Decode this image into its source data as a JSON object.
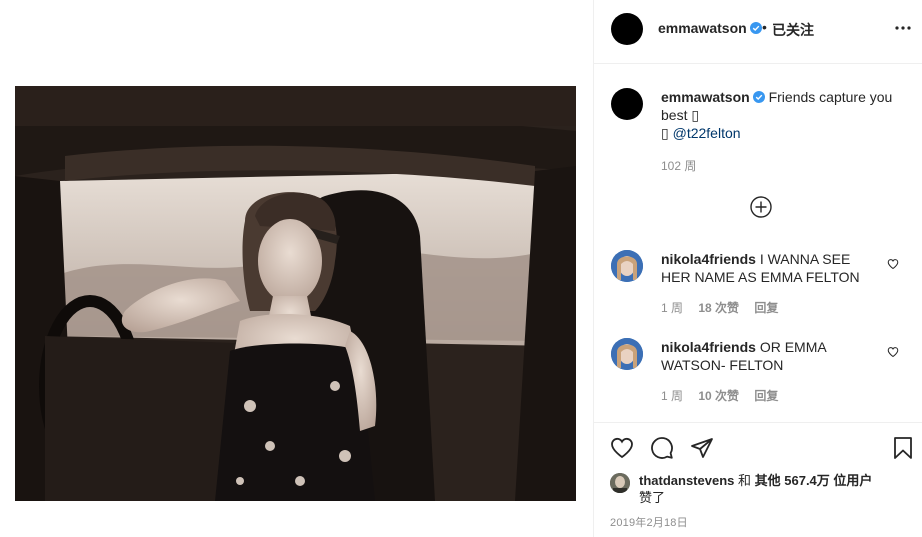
{
  "header": {
    "username": "emmawatson",
    "separator": "•",
    "follow_status": "已关注",
    "more_icon": "more-horizontal-icon"
  },
  "caption": {
    "username": "emmawatson",
    "text": "Friends capture you best",
    "emoji_1": "▯",
    "emoji_2": "▯",
    "mention": "@t22felton",
    "time": "102 周"
  },
  "load_more_icon": "plus-circle-icon",
  "comments": [
    {
      "username": "nikola4friends",
      "text": "I WANNA SEE HER NAME AS EMMA FELTON",
      "time": "1 周",
      "likes": "18 次赞",
      "reply": "回复"
    },
    {
      "username": "nikola4friends",
      "text": "OR EMMA WATSON- FELTON",
      "time": "1 周",
      "likes": "10 次赞",
      "reply": "回复"
    }
  ],
  "actions": {
    "like_icon": "heart-icon",
    "comment_icon": "comment-icon",
    "share_icon": "paper-plane-icon",
    "save_icon": "bookmark-icon"
  },
  "likes": {
    "user": "thatdanstevens",
    "and": "和",
    "others": "其他 567.4万 位用户",
    "liked": "赞了"
  },
  "date": "2019年2月18日",
  "colors": {
    "verified": "#3897f0",
    "text": "#262626",
    "muted": "#8e8e8e",
    "mention": "#00376b",
    "border": "#efefef"
  }
}
